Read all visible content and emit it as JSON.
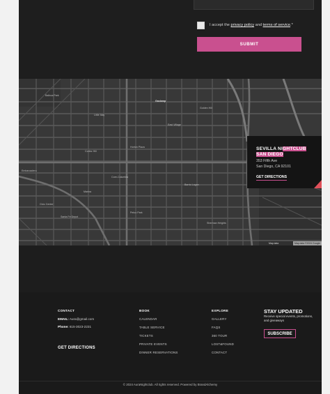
{
  "form": {
    "consent_prefix": "I accept the",
    "privacy_link": "privacy policy",
    "consent_and": "and",
    "terms_link": "terms of service",
    "required_mark": ".*",
    "submit_label": "SUBMIT"
  },
  "map": {
    "venue_name_part1": "SEVILLA NI",
    "venue_name_part2": "GHTCLUB",
    "venue_name_line2": "SAN DIEGO",
    "address_line1": "353 Fifth Ave",
    "address_line2": "San Diego, CA 92101",
    "directions_label": "GET DIRECTIONS",
    "attribution": "Map data ©2024 Google",
    "attribution_left": "Map data",
    "highlight_color": "#c9508f",
    "place_labels": [
      "Balboa Park",
      "Gaslamp",
      "Petco Park",
      "Little Italy",
      "Barrio Logan",
      "Cortez Hill",
      "Core-Columbia",
      "Marina",
      "East Village",
      "Horton Plaza",
      "Civic Center",
      "Santa Fe Depot",
      "Embarcadero",
      "Sherman Heights",
      "Golden Hill"
    ]
  },
  "footer": {
    "contact": {
      "title": "CONTACT",
      "email_label": "EMAIL:",
      "email_value": "Aura@gmail.com",
      "phone_label": "Phone:",
      "phone_value": "615-3023-2231",
      "get_directions": "GET DIRECTIONS"
    },
    "book": {
      "title": "BOOK",
      "links": [
        "CALENDAR",
        "TABLE SERVICE",
        "TICKETS",
        "PRIVATE EVENTS",
        "DINNER RESERVATIONS"
      ]
    },
    "explore": {
      "title": "EXPLORE",
      "links": [
        "GALLERY",
        "FAQS",
        "360 TOUR",
        "LOST&FOUND",
        "CONTACT"
      ]
    },
    "stay": {
      "title": "STAY UPDATED",
      "subtitle": "Receive special events, promotions, and giveaways",
      "subscribe_label": "SUBSCRIBE"
    },
    "copyright": "© 2024 AuraNightclub. All rights reserved. Powered by BrandAlchemy"
  }
}
